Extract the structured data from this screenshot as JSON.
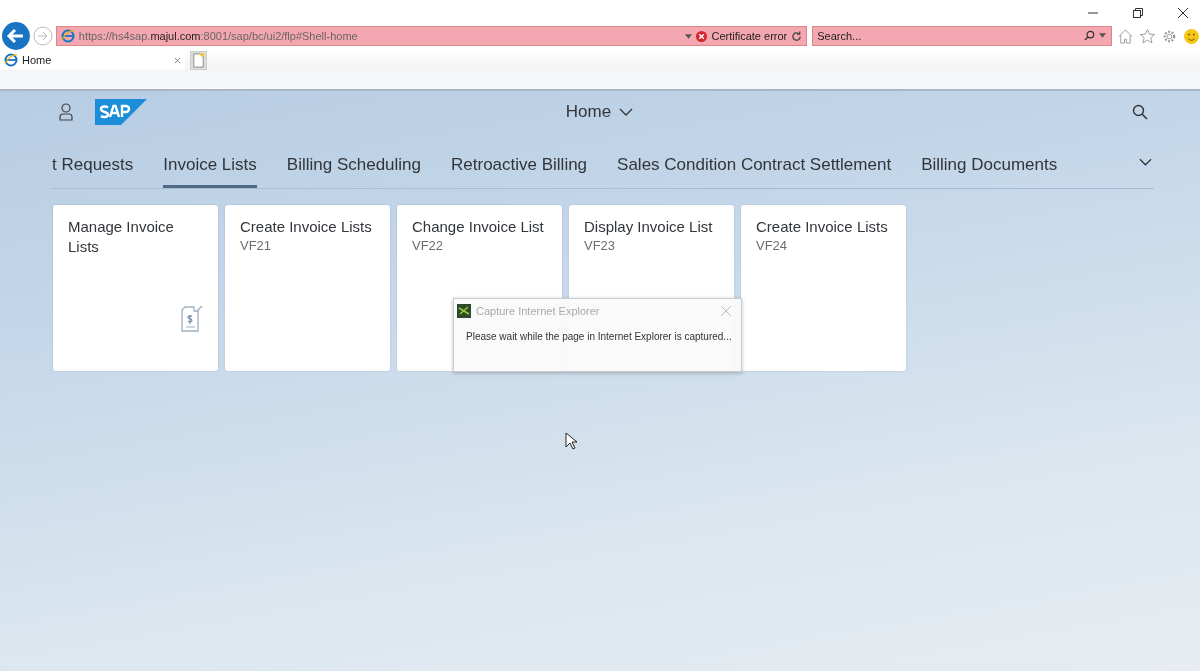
{
  "browser": {
    "address": "https://hs4sap.**majul.com**:8001/sap/bc/ui2/flp#Shell-home",
    "certificate": "Certificate error",
    "search": {
      "placeholder": "Search..."
    },
    "tab": {
      "title": "Home",
      "selected": true
    }
  },
  "shell": {
    "title": "Home"
  },
  "tabs": [
    {
      "label": "t Requests",
      "selected": false
    },
    {
      "label": "Invoice Lists",
      "selected": true
    },
    {
      "label": "Billing Scheduling",
      "selected": false
    },
    {
      "label": "Retroactive Billing",
      "selected": false
    },
    {
      "label": "Sales Condition Contract Settlement",
      "selected": false
    },
    {
      "label": "Billing Documents",
      "selected": false
    }
  ],
  "tiles": [
    {
      "title": "Manage Invoice Lists",
      "kind": "app"
    },
    {
      "title": "Create Invoice Lists",
      "subtitle": "VF21",
      "kind": "transaction"
    },
    {
      "title": "Change Invoice List",
      "subtitle": "VF22",
      "kind": "transaction"
    },
    {
      "title": "Display Invoice List",
      "subtitle": "VF23",
      "kind": "transaction"
    },
    {
      "title": "Create Invoice Lists",
      "subtitle": "VF24",
      "kind": "transaction"
    }
  ],
  "dialog": {
    "title": "Capture Internet Explorer",
    "message": "Please wait while the page in Internet Explorer is captured..."
  }
}
